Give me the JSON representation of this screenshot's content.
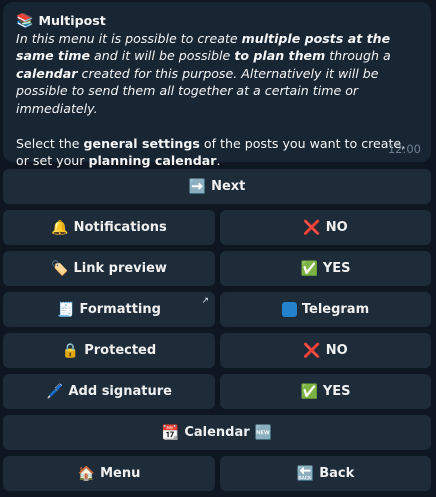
{
  "message": {
    "title_emoji": "📚",
    "title": "Multipost",
    "intro_segments": [
      {
        "text": "In this menu it is possible to create ",
        "bold": false
      },
      {
        "text": "multiple posts at the same time",
        "bold": true
      },
      {
        "text": " and it will be possible ",
        "bold": false
      },
      {
        "text": "to plan them",
        "bold": true
      },
      {
        "text": " through a ",
        "bold": false
      },
      {
        "text": "calendar",
        "bold": true
      },
      {
        "text": " created for this purpose. Alternatively it will be possible to send them all together at a certain time or immediately.",
        "bold": false
      }
    ],
    "body_segments": [
      {
        "text": "Select the ",
        "bold": false
      },
      {
        "text": "general settings",
        "bold": true
      },
      {
        "text": " of the posts you want to create, or set your ",
        "bold": false
      },
      {
        "text": "planning calendar",
        "bold": true
      },
      {
        "text": ".",
        "bold": false
      }
    ],
    "time": "12:00"
  },
  "keyboard": {
    "next": {
      "icon": "➡️",
      "label": "Next"
    },
    "notifications": {
      "icon": "🔔",
      "label": "Notifications"
    },
    "notifications_value": {
      "icon": "❌",
      "label": "NO"
    },
    "link_preview": {
      "icon": "🏷️",
      "label": "Link preview"
    },
    "link_preview_value": {
      "icon": "✅",
      "label": "YES"
    },
    "formatting": {
      "icon": "🧾",
      "label": "Formatting",
      "corner": "↗"
    },
    "formatting_value": {
      "icon": "🟦",
      "label": "Telegram"
    },
    "protected": {
      "icon": "🔒",
      "label": "Protected"
    },
    "protected_value": {
      "icon": "❌",
      "label": "NO"
    },
    "add_signature": {
      "icon": "🖊️",
      "label": "Add signature"
    },
    "add_signature_value": {
      "icon": "✅",
      "label": "YES"
    },
    "calendar": {
      "icon": "📆",
      "label": "Calendar",
      "badge": "🆕"
    },
    "menu": {
      "icon": "🏠",
      "label": "Menu"
    },
    "back": {
      "icon": "🔙",
      "label": "Back"
    }
  },
  "colors": {
    "background": "#0e1621",
    "bubble": "#182533",
    "button": "#1e2c3a",
    "no_red": "#e0262d",
    "yes_green": "#3cb043",
    "telegram_blue": "#2481cc"
  }
}
